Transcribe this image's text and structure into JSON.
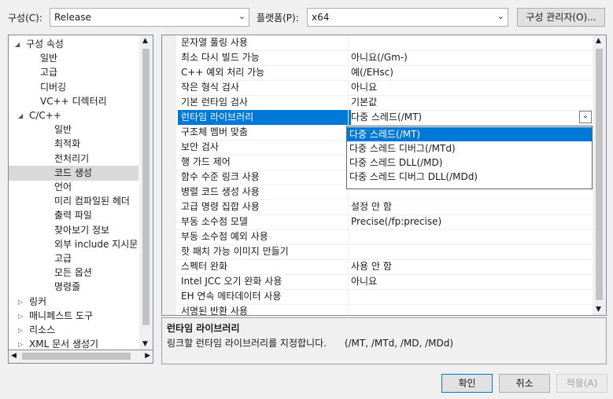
{
  "toolbar": {
    "config_label": "구성(C):",
    "config_value": "Release",
    "platform_label": "플랫폼(P):",
    "platform_value": "x64",
    "config_manager_label": "구성 관리자(O)..."
  },
  "tree": {
    "items": [
      {
        "label": "구성 속성"
      },
      {
        "label": "일반"
      },
      {
        "label": "고급"
      },
      {
        "label": "디버깅"
      },
      {
        "label": "VC++ 디렉터리"
      },
      {
        "label": "C/C++"
      },
      {
        "label": "일반"
      },
      {
        "label": "최적화"
      },
      {
        "label": "전처리기"
      },
      {
        "label": "코드 생성"
      },
      {
        "label": "언어"
      },
      {
        "label": "미리 컴파일된 헤더"
      },
      {
        "label": "출력 파일"
      },
      {
        "label": "찾아보기 정보"
      },
      {
        "label": "외부 include 지시문"
      },
      {
        "label": "고급"
      },
      {
        "label": "모든 옵션"
      },
      {
        "label": "명령줄"
      },
      {
        "label": "링커"
      },
      {
        "label": "매니페스트 도구"
      },
      {
        "label": "리소스"
      },
      {
        "label": "XML 문서 생성기"
      }
    ]
  },
  "grid": {
    "rows": [
      {
        "name": "문자열 풀링 사용",
        "value": ""
      },
      {
        "name": "최소 다시 빌드 가능",
        "value": "아니요(/Gm-)"
      },
      {
        "name": "C++ 예외 처리 가능",
        "value": "예(/EHsc)"
      },
      {
        "name": "작은 형식 검사",
        "value": "아니요"
      },
      {
        "name": "기본 런타임 검사",
        "value": "기본값"
      },
      {
        "name": "런타임 라이브러리",
        "value": "다중 스레드(/MT)"
      },
      {
        "name": "구조체 멤버 맞춤",
        "value": ""
      },
      {
        "name": "보안 검사",
        "value": ""
      },
      {
        "name": "행 가드 제어",
        "value": ""
      },
      {
        "name": "함수 수준 링크 사용",
        "value": ""
      },
      {
        "name": "병렬 코드 생성 사용",
        "value": ""
      },
      {
        "name": "고급 명령 집합 사용",
        "value": "설정 안 함"
      },
      {
        "name": "부동 소수점 모델",
        "value": "Precise(/fp:precise)"
      },
      {
        "name": "부동 소수점 예외 사용",
        "value": ""
      },
      {
        "name": "핫 패치 가능 이미지 만들기",
        "value": ""
      },
      {
        "name": "스펙터 완화",
        "value": "사용 안 함"
      },
      {
        "name": "Intel JCC 오기 완화 사용",
        "value": "아니요"
      },
      {
        "name": "EH 연속 메타데이터 사용",
        "value": ""
      },
      {
        "name": "서명된 반환 사용",
        "value": ""
      }
    ]
  },
  "dropdown": {
    "options": [
      "다중 스레드(/MT)",
      "다중 스레드 디버그(/MTd)",
      "다중 스레드 DLL(/MD)",
      "다중 스레드 디버그 DLL(/MDd)"
    ]
  },
  "description": {
    "title": "런타임 라이브러리",
    "text": "링크할 런타임 라이브러리를 지정합니다.      (/MT, /MTd, /MD, /MDd)"
  },
  "buttons": {
    "ok": "확인",
    "cancel": "취소",
    "apply": "적용(A)"
  },
  "icons": {
    "expanded": "triangle-down-icon",
    "collapsed": "triangle-right-icon",
    "combo_arrow": "chevron-down-icon"
  },
  "colors": {
    "selection": "#0078d7",
    "tree_selection": "#d9d9d9",
    "background": "#f0f0f0"
  }
}
